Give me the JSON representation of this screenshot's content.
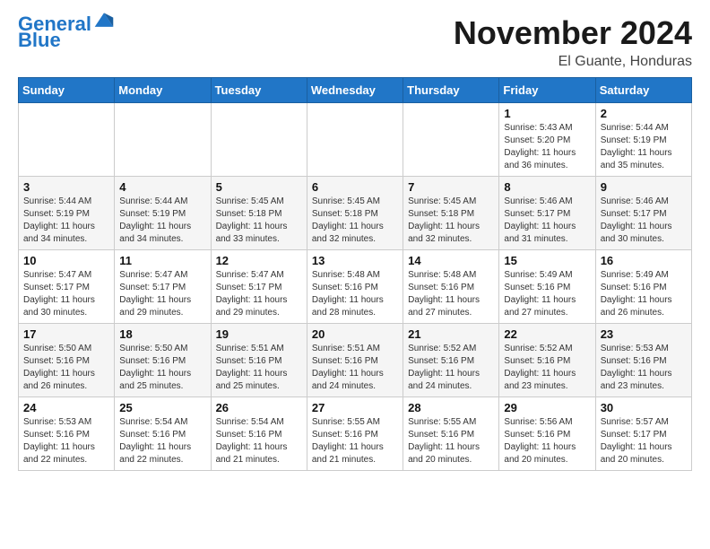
{
  "header": {
    "logo_line1": "General",
    "logo_line2": "Blue",
    "month": "November 2024",
    "location": "El Guante, Honduras"
  },
  "weekdays": [
    "Sunday",
    "Monday",
    "Tuesday",
    "Wednesday",
    "Thursday",
    "Friday",
    "Saturday"
  ],
  "weeks": [
    [
      {
        "day": "",
        "info": ""
      },
      {
        "day": "",
        "info": ""
      },
      {
        "day": "",
        "info": ""
      },
      {
        "day": "",
        "info": ""
      },
      {
        "day": "",
        "info": ""
      },
      {
        "day": "1",
        "info": "Sunrise: 5:43 AM\nSunset: 5:20 PM\nDaylight: 11 hours\nand 36 minutes."
      },
      {
        "day": "2",
        "info": "Sunrise: 5:44 AM\nSunset: 5:19 PM\nDaylight: 11 hours\nand 35 minutes."
      }
    ],
    [
      {
        "day": "3",
        "info": "Sunrise: 5:44 AM\nSunset: 5:19 PM\nDaylight: 11 hours\nand 34 minutes."
      },
      {
        "day": "4",
        "info": "Sunrise: 5:44 AM\nSunset: 5:19 PM\nDaylight: 11 hours\nand 34 minutes."
      },
      {
        "day": "5",
        "info": "Sunrise: 5:45 AM\nSunset: 5:18 PM\nDaylight: 11 hours\nand 33 minutes."
      },
      {
        "day": "6",
        "info": "Sunrise: 5:45 AM\nSunset: 5:18 PM\nDaylight: 11 hours\nand 32 minutes."
      },
      {
        "day": "7",
        "info": "Sunrise: 5:45 AM\nSunset: 5:18 PM\nDaylight: 11 hours\nand 32 minutes."
      },
      {
        "day": "8",
        "info": "Sunrise: 5:46 AM\nSunset: 5:17 PM\nDaylight: 11 hours\nand 31 minutes."
      },
      {
        "day": "9",
        "info": "Sunrise: 5:46 AM\nSunset: 5:17 PM\nDaylight: 11 hours\nand 30 minutes."
      }
    ],
    [
      {
        "day": "10",
        "info": "Sunrise: 5:47 AM\nSunset: 5:17 PM\nDaylight: 11 hours\nand 30 minutes."
      },
      {
        "day": "11",
        "info": "Sunrise: 5:47 AM\nSunset: 5:17 PM\nDaylight: 11 hours\nand 29 minutes."
      },
      {
        "day": "12",
        "info": "Sunrise: 5:47 AM\nSunset: 5:17 PM\nDaylight: 11 hours\nand 29 minutes."
      },
      {
        "day": "13",
        "info": "Sunrise: 5:48 AM\nSunset: 5:16 PM\nDaylight: 11 hours\nand 28 minutes."
      },
      {
        "day": "14",
        "info": "Sunrise: 5:48 AM\nSunset: 5:16 PM\nDaylight: 11 hours\nand 27 minutes."
      },
      {
        "day": "15",
        "info": "Sunrise: 5:49 AM\nSunset: 5:16 PM\nDaylight: 11 hours\nand 27 minutes."
      },
      {
        "day": "16",
        "info": "Sunrise: 5:49 AM\nSunset: 5:16 PM\nDaylight: 11 hours\nand 26 minutes."
      }
    ],
    [
      {
        "day": "17",
        "info": "Sunrise: 5:50 AM\nSunset: 5:16 PM\nDaylight: 11 hours\nand 26 minutes."
      },
      {
        "day": "18",
        "info": "Sunrise: 5:50 AM\nSunset: 5:16 PM\nDaylight: 11 hours\nand 25 minutes."
      },
      {
        "day": "19",
        "info": "Sunrise: 5:51 AM\nSunset: 5:16 PM\nDaylight: 11 hours\nand 25 minutes."
      },
      {
        "day": "20",
        "info": "Sunrise: 5:51 AM\nSunset: 5:16 PM\nDaylight: 11 hours\nand 24 minutes."
      },
      {
        "day": "21",
        "info": "Sunrise: 5:52 AM\nSunset: 5:16 PM\nDaylight: 11 hours\nand 24 minutes."
      },
      {
        "day": "22",
        "info": "Sunrise: 5:52 AM\nSunset: 5:16 PM\nDaylight: 11 hours\nand 23 minutes."
      },
      {
        "day": "23",
        "info": "Sunrise: 5:53 AM\nSunset: 5:16 PM\nDaylight: 11 hours\nand 23 minutes."
      }
    ],
    [
      {
        "day": "24",
        "info": "Sunrise: 5:53 AM\nSunset: 5:16 PM\nDaylight: 11 hours\nand 22 minutes."
      },
      {
        "day": "25",
        "info": "Sunrise: 5:54 AM\nSunset: 5:16 PM\nDaylight: 11 hours\nand 22 minutes."
      },
      {
        "day": "26",
        "info": "Sunrise: 5:54 AM\nSunset: 5:16 PM\nDaylight: 11 hours\nand 21 minutes."
      },
      {
        "day": "27",
        "info": "Sunrise: 5:55 AM\nSunset: 5:16 PM\nDaylight: 11 hours\nand 21 minutes."
      },
      {
        "day": "28",
        "info": "Sunrise: 5:55 AM\nSunset: 5:16 PM\nDaylight: 11 hours\nand 20 minutes."
      },
      {
        "day": "29",
        "info": "Sunrise: 5:56 AM\nSunset: 5:16 PM\nDaylight: 11 hours\nand 20 minutes."
      },
      {
        "day": "30",
        "info": "Sunrise: 5:57 AM\nSunset: 5:17 PM\nDaylight: 11 hours\nand 20 minutes."
      }
    ]
  ]
}
